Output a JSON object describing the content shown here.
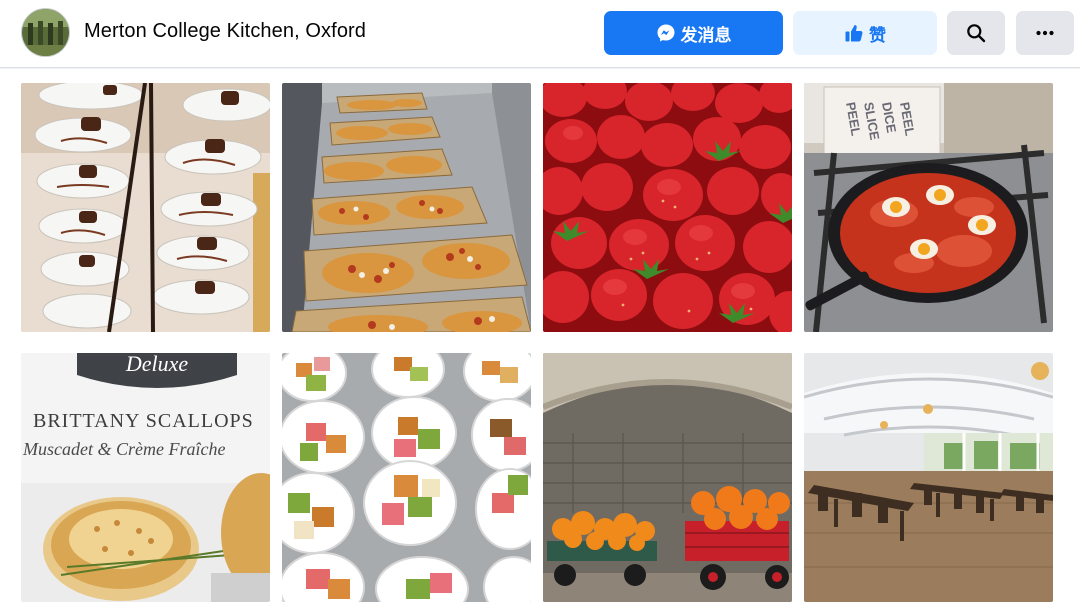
{
  "page": {
    "title": "Merton College Kitchen, Oxford"
  },
  "actions": {
    "message_label": "发消息",
    "like_label": "赞"
  },
  "icons": {
    "messenger": "messenger-icon",
    "like": "thumbs-up-icon",
    "search": "search-icon",
    "more": "more-horizontal-icon"
  },
  "colors": {
    "primary": "#1877f2",
    "primary_light": "#e7f3ff",
    "secondary_btn": "#e4e6eb",
    "page_bg": "#f0f2f5"
  },
  "photo_text": {
    "box_brand": "Deluxe",
    "box_title": "BRITTANY SCALLOPS",
    "box_subtitle": "Muscadet & Crème Fraîche",
    "sign_words": [
      "PEEL",
      "SLICE",
      "DICE",
      "PEEL"
    ]
  }
}
